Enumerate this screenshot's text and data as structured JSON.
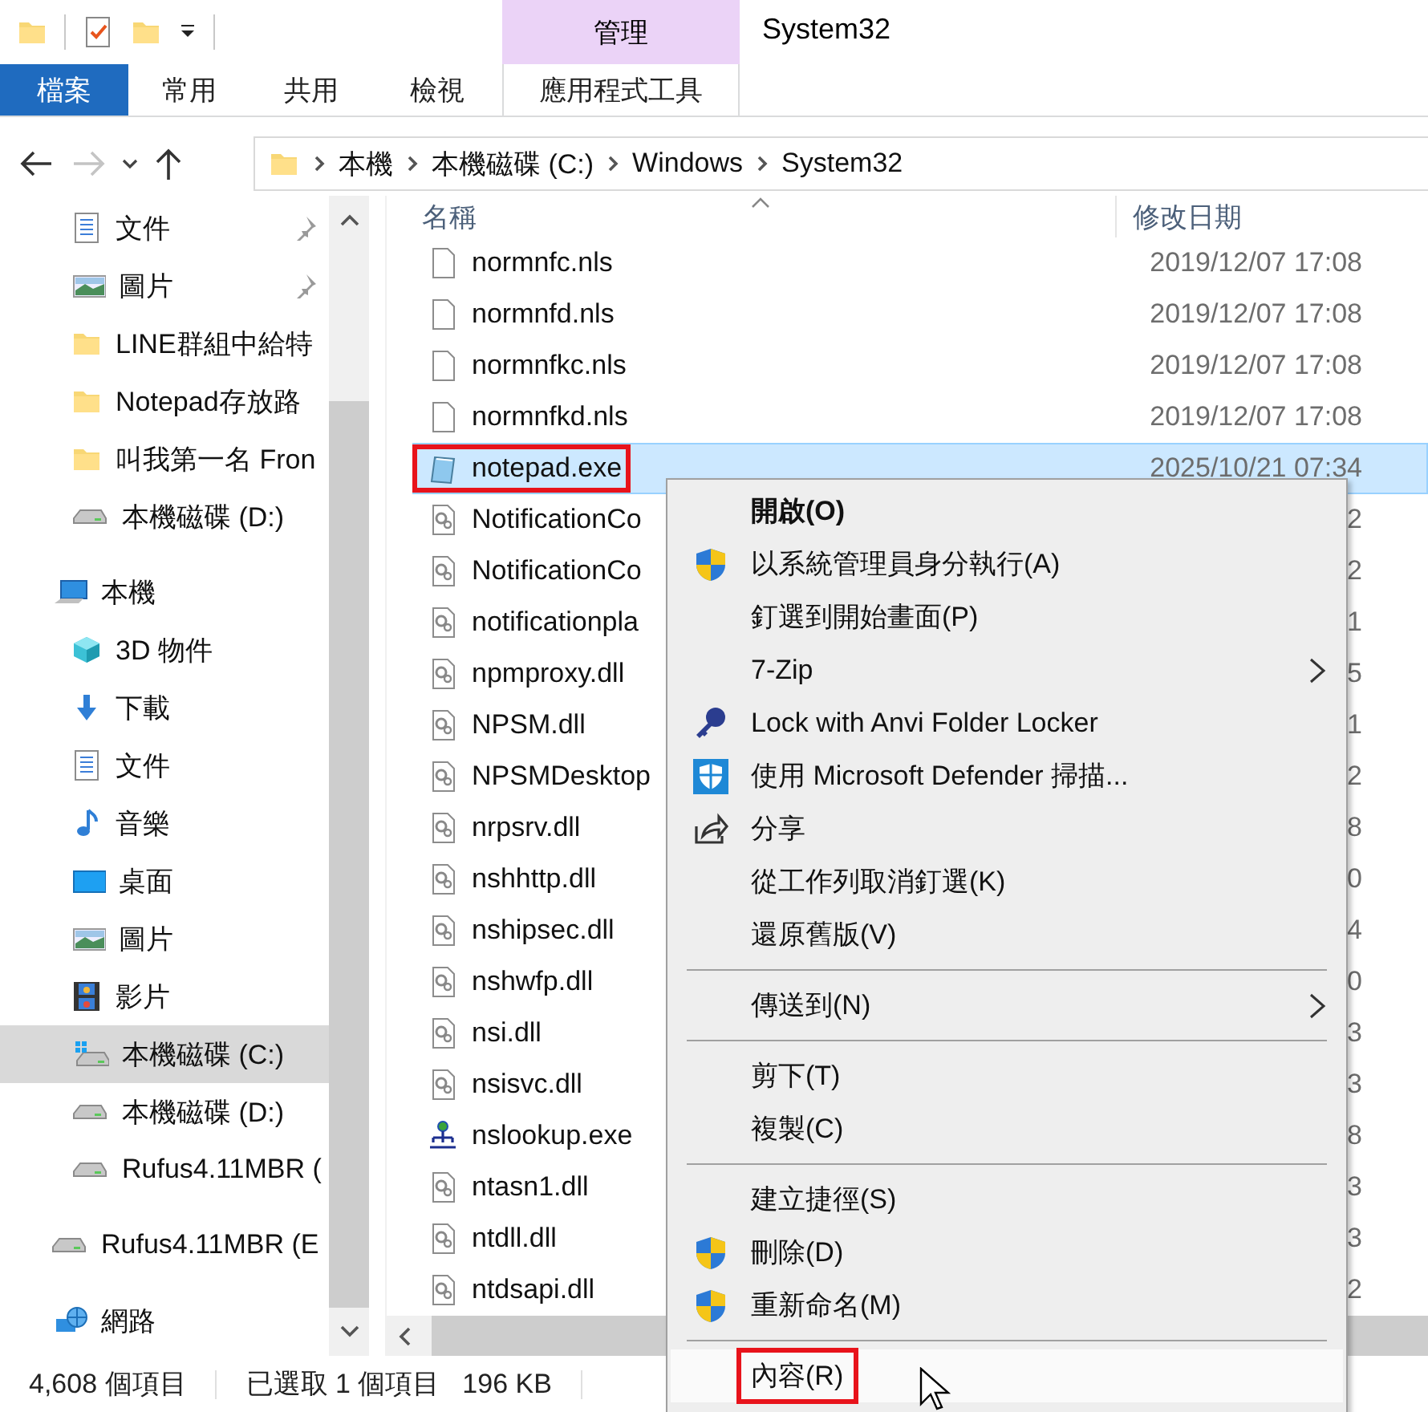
{
  "window": {
    "title": "System32"
  },
  "ribbon": {
    "context_tab": "管理",
    "tabs": [
      {
        "label": "檔案",
        "kind": "file"
      },
      {
        "label": "常用",
        "kind": "normal"
      },
      {
        "label": "共用",
        "kind": "normal"
      },
      {
        "label": "檢視",
        "kind": "normal"
      },
      {
        "label": "應用程式工具",
        "kind": "context"
      }
    ]
  },
  "navigation": {
    "forward_disabled": true
  },
  "address": {
    "segments": [
      "本機",
      "本機磁碟 (C:)",
      "Windows",
      "System32"
    ]
  },
  "quick_access": [
    {
      "label": "文件",
      "kind": "document",
      "pinned": true,
      "selected": false
    },
    {
      "label": "圖片",
      "kind": "picture",
      "pinned": true,
      "selected": false
    },
    {
      "label": "LINE群組中給特",
      "kind": "folder",
      "pinned": false,
      "selected": false
    },
    {
      "label": "Notepad存放路",
      "kind": "folder",
      "pinned": false,
      "selected": false
    },
    {
      "label": "叫我第一名 Fron",
      "kind": "folder",
      "pinned": false,
      "selected": false
    },
    {
      "label": "本機磁碟 (D:)",
      "kind": "drive",
      "pinned": false,
      "selected": false
    }
  ],
  "tree": [
    {
      "label": "本機",
      "kind": "pc",
      "selected": false,
      "children": [
        {
          "label": "3D 物件",
          "kind": "cube",
          "selected": false
        },
        {
          "label": "下載",
          "kind": "download",
          "selected": false
        },
        {
          "label": "文件",
          "kind": "document",
          "selected": false
        },
        {
          "label": "音樂",
          "kind": "music",
          "selected": false
        },
        {
          "label": "桌面",
          "kind": "desktop",
          "selected": false
        },
        {
          "label": "圖片",
          "kind": "picture",
          "selected": false
        },
        {
          "label": "影片",
          "kind": "video",
          "selected": false
        },
        {
          "label": "本機磁碟 (C:)",
          "kind": "windrive",
          "selected": true
        },
        {
          "label": "本機磁碟 (D:)",
          "kind": "drive",
          "selected": false
        },
        {
          "label": "Rufus4.11MBR (",
          "kind": "drive",
          "selected": false
        }
      ]
    },
    {
      "label": "Rufus4.11MBR (E",
      "kind": "drive",
      "selected": false
    },
    {
      "label": "網路",
      "kind": "network",
      "selected": false
    }
  ],
  "file_list": {
    "columns": [
      "名稱",
      "修改日期"
    ],
    "files": [
      {
        "name": "normnfc.nls",
        "modified": "2019/12/07 17:08",
        "kind": "file",
        "selected": false,
        "outlined": false
      },
      {
        "name": "normnfd.nls",
        "modified": "2019/12/07 17:08",
        "kind": "file",
        "selected": false,
        "outlined": false
      },
      {
        "name": "normnfkc.nls",
        "modified": "2019/12/07 17:08",
        "kind": "file",
        "selected": false,
        "outlined": false
      },
      {
        "name": "normnfkd.nls",
        "modified": "2019/12/07 17:08",
        "kind": "file",
        "selected": false,
        "outlined": false
      },
      {
        "name": "notepad.exe",
        "modified": "2025/10/21 07:34",
        "kind": "app",
        "selected": true,
        "outlined": true
      },
      {
        "name": "NotificationCo",
        "modified": "2",
        "kind": "library",
        "selected": false,
        "outlined": false
      },
      {
        "name": "NotificationCo",
        "modified": "2",
        "kind": "library",
        "selected": false,
        "outlined": false
      },
      {
        "name": "notificationpla",
        "modified": "1",
        "kind": "library",
        "selected": false,
        "outlined": false
      },
      {
        "name": "npmproxy.dll",
        "modified": "5",
        "kind": "library",
        "selected": false,
        "outlined": false
      },
      {
        "name": "NPSM.dll",
        "modified": "1",
        "kind": "library",
        "selected": false,
        "outlined": false
      },
      {
        "name": "NPSMDesktop",
        "modified": "2",
        "kind": "library",
        "selected": false,
        "outlined": false
      },
      {
        "name": "nrpsrv.dll",
        "modified": "8",
        "kind": "library",
        "selected": false,
        "outlined": false
      },
      {
        "name": "nshhttp.dll",
        "modified": "0",
        "kind": "library",
        "selected": false,
        "outlined": false
      },
      {
        "name": "nshipsec.dll",
        "modified": "4",
        "kind": "library",
        "selected": false,
        "outlined": false
      },
      {
        "name": "nshwfp.dll",
        "modified": "0",
        "kind": "library",
        "selected": false,
        "outlined": false
      },
      {
        "name": "nsi.dll",
        "modified": "3",
        "kind": "library",
        "selected": false,
        "outlined": false
      },
      {
        "name": "nsisvc.dll",
        "modified": "3",
        "kind": "library",
        "selected": false,
        "outlined": false
      },
      {
        "name": "nslookup.exe",
        "modified": "8",
        "kind": "netapp",
        "selected": false,
        "outlined": false
      },
      {
        "name": "ntasn1.dll",
        "modified": "3",
        "kind": "library",
        "selected": false,
        "outlined": false
      },
      {
        "name": "ntdll.dll",
        "modified": "3",
        "kind": "library",
        "selected": false,
        "outlined": false
      },
      {
        "name": "ntdsapi.dll",
        "modified": "2",
        "kind": "library",
        "selected": false,
        "outlined": false
      }
    ]
  },
  "context_menu": {
    "groups": [
      [
        {
          "label": "開啟(O)",
          "kind": "plain",
          "default": true,
          "submenu": false,
          "hovered": false,
          "outlined": false
        },
        {
          "label": "以系統管理員身分執行(A)",
          "kind": "elevated",
          "default": false,
          "submenu": false,
          "hovered": false,
          "outlined": false
        },
        {
          "label": "釘選到開始畫面(P)",
          "kind": "plain",
          "default": false,
          "submenu": false,
          "hovered": false,
          "outlined": false
        },
        {
          "label": "7-Zip",
          "kind": "plain",
          "default": false,
          "submenu": true,
          "hovered": false,
          "outlined": false
        },
        {
          "label": "Lock with Anvi Folder Locker",
          "kind": "lock",
          "default": false,
          "submenu": false,
          "hovered": false,
          "outlined": false
        },
        {
          "label": "使用 Microsoft Defender 掃描...",
          "kind": "scan",
          "default": false,
          "submenu": false,
          "hovered": false,
          "outlined": false
        },
        {
          "label": "分享",
          "kind": "share",
          "default": false,
          "submenu": false,
          "hovered": false,
          "outlined": false
        },
        {
          "label": "從工作列取消釘選(K)",
          "kind": "plain",
          "default": false,
          "submenu": false,
          "hovered": false,
          "outlined": false
        },
        {
          "label": "還原舊版(V)",
          "kind": "plain",
          "default": false,
          "submenu": false,
          "hovered": false,
          "outlined": false
        }
      ],
      [
        {
          "label": "傳送到(N)",
          "kind": "plain",
          "default": false,
          "submenu": true,
          "hovered": false,
          "outlined": false
        }
      ],
      [
        {
          "label": "剪下(T)",
          "kind": "plain",
          "default": false,
          "submenu": false,
          "hovered": false,
          "outlined": false
        },
        {
          "label": "複製(C)",
          "kind": "plain",
          "default": false,
          "submenu": false,
          "hovered": false,
          "outlined": false
        }
      ],
      [
        {
          "label": "建立捷徑(S)",
          "kind": "plain",
          "default": false,
          "submenu": false,
          "hovered": false,
          "outlined": false
        },
        {
          "label": "刪除(D)",
          "kind": "elevated",
          "default": false,
          "submenu": false,
          "hovered": false,
          "outlined": false
        },
        {
          "label": "重新命名(M)",
          "kind": "elevated",
          "default": false,
          "submenu": false,
          "hovered": false,
          "outlined": false
        }
      ],
      [
        {
          "label": "內容(R)",
          "kind": "plain",
          "default": false,
          "submenu": false,
          "hovered": true,
          "outlined": true
        }
      ]
    ]
  },
  "status_bar": {
    "items": [
      "4,608 個項目",
      "已選取 1 個項目",
      "196 KB"
    ]
  }
}
